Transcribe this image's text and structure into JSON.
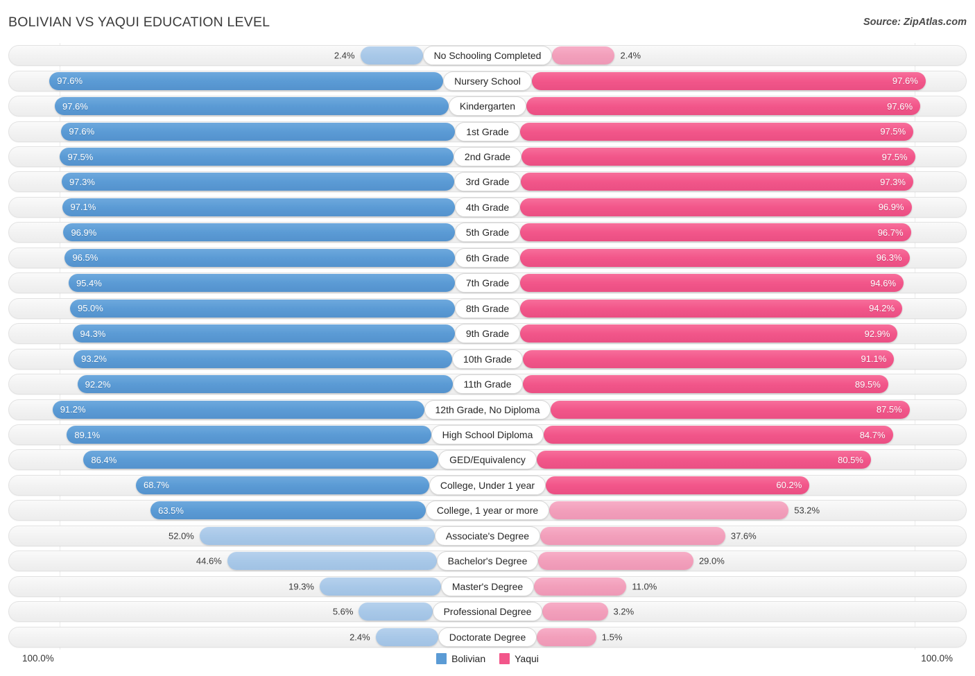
{
  "header": {
    "title": "BOLIVIAN VS YAQUI EDUCATION LEVEL",
    "source": "Source: ZipAtlas.com"
  },
  "footer": {
    "axis_min": "100.0%",
    "axis_max": "100.0%",
    "legend": [
      {
        "label": "Bolivian",
        "color": "#5b9bd5",
        "swatch": "blue"
      },
      {
        "label": "Yaqui",
        "color": "#f2568a",
        "swatch": "pink"
      }
    ]
  },
  "chart_data": {
    "type": "bar",
    "subtype": "diverging-bidirectional",
    "title": "BOLIVIAN VS YAQUI EDUCATION LEVEL",
    "xlabel": "",
    "ylabel": "",
    "xlim": [
      0,
      100
    ],
    "grid": true,
    "legend_position": "bottom-center",
    "axis_left_label": "100.0%",
    "axis_right_label": "100.0%",
    "categories": [
      "No Schooling Completed",
      "Nursery School",
      "Kindergarten",
      "1st Grade",
      "2nd Grade",
      "3rd Grade",
      "4th Grade",
      "5th Grade",
      "6th Grade",
      "7th Grade",
      "8th Grade",
      "9th Grade",
      "10th Grade",
      "11th Grade",
      "12th Grade, No Diploma",
      "High School Diploma",
      "GED/Equivalency",
      "College, Under 1 year",
      "College, 1 year or more",
      "Associate's Degree",
      "Bachelor's Degree",
      "Master's Degree",
      "Professional Degree",
      "Doctorate Degree"
    ],
    "series": [
      {
        "name": "Bolivian",
        "color": "#5b9bd5",
        "side": "left",
        "values": [
          2.4,
          97.6,
          97.6,
          97.6,
          97.5,
          97.3,
          97.1,
          96.9,
          96.5,
          95.4,
          95.0,
          94.3,
          93.2,
          92.2,
          91.2,
          89.1,
          86.4,
          68.7,
          63.5,
          52.0,
          44.6,
          19.3,
          5.6,
          2.4
        ],
        "labels": [
          "2.4%",
          "97.6%",
          "97.6%",
          "97.6%",
          "97.5%",
          "97.3%",
          "97.1%",
          "96.9%",
          "96.5%",
          "95.4%",
          "95.0%",
          "94.3%",
          "93.2%",
          "92.2%",
          "91.2%",
          "89.1%",
          "86.4%",
          "68.7%",
          "63.5%",
          "52.0%",
          "44.6%",
          "19.3%",
          "5.6%",
          "2.4%"
        ]
      },
      {
        "name": "Yaqui",
        "color": "#f2568a",
        "side": "right",
        "values": [
          2.4,
          97.6,
          97.6,
          97.5,
          97.5,
          97.3,
          96.9,
          96.7,
          96.3,
          94.6,
          94.2,
          92.9,
          91.1,
          89.5,
          87.5,
          84.7,
          80.5,
          60.2,
          53.2,
          37.6,
          29.0,
          11.0,
          3.2,
          1.5
        ],
        "labels": [
          "2.4%",
          "97.6%",
          "97.6%",
          "97.5%",
          "97.5%",
          "97.3%",
          "96.9%",
          "96.7%",
          "96.3%",
          "94.6%",
          "94.2%",
          "92.9%",
          "91.1%",
          "89.5%",
          "87.5%",
          "84.7%",
          "80.5%",
          "60.2%",
          "53.2%",
          "37.6%",
          "29.0%",
          "11.0%",
          "3.2%",
          "1.5%"
        ]
      }
    ]
  }
}
